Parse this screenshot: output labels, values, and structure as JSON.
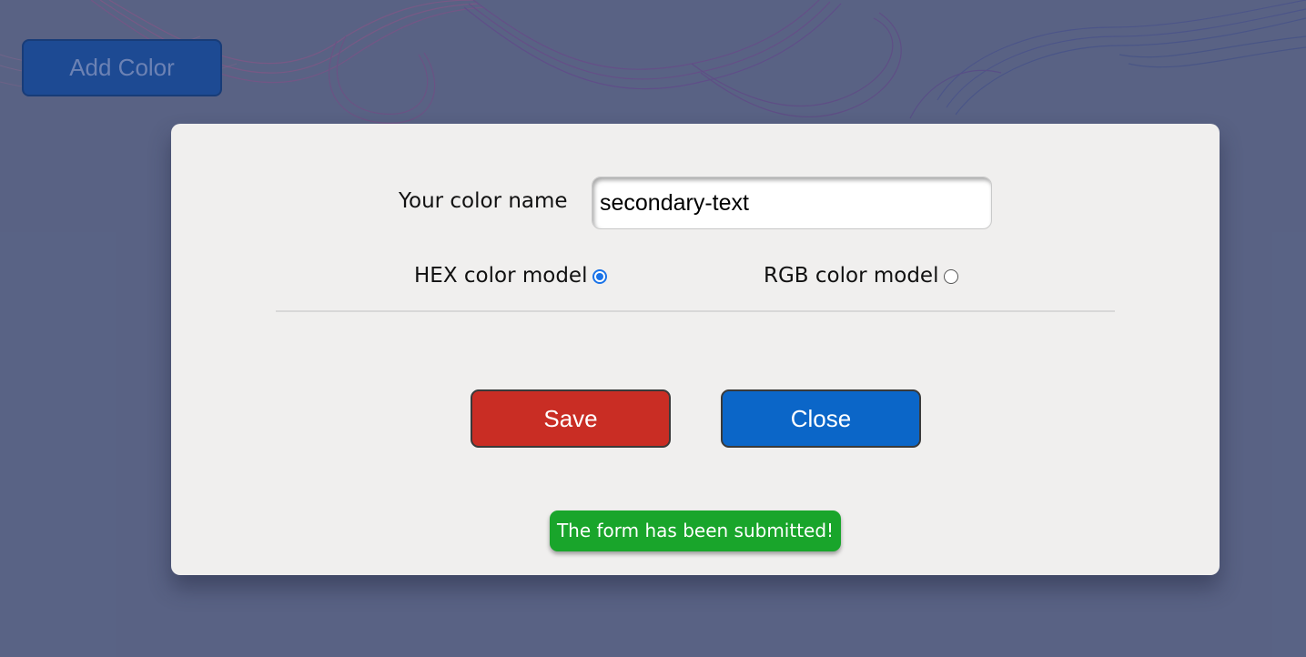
{
  "background": {
    "base_color": "#5b6586",
    "art_colors": [
      "#8a3a7a",
      "#6a2d8a",
      "#2c3e8a"
    ]
  },
  "toolbar": {
    "add_color_label": "Add Color"
  },
  "modal": {
    "name_label": "Your color name",
    "name_value": "secondary-text",
    "radios": {
      "hex_label": "HEX color model",
      "hex_checked": true,
      "rgb_label": "RGB color model",
      "rgb_checked": false
    },
    "save_label": "Save",
    "close_label": "Close",
    "status_message": "The form has been submitted!"
  },
  "colors": {
    "save": "#c92d24",
    "close": "#0b66c8",
    "success": "#19a52b",
    "radio_accent": "#1a73e8"
  }
}
